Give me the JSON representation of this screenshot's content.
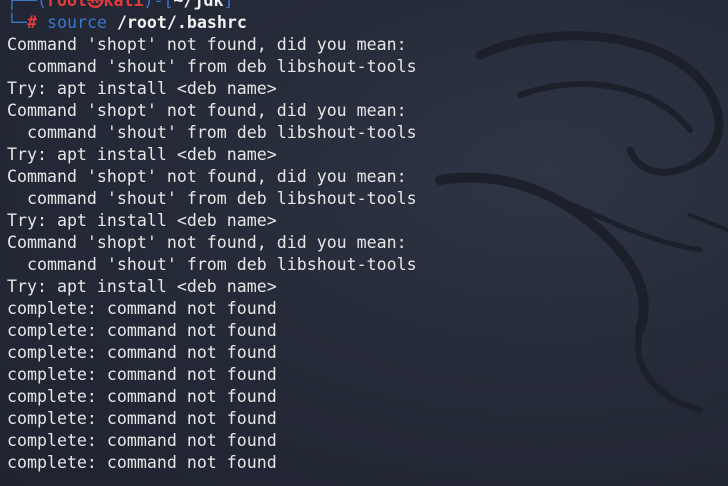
{
  "prompt": {
    "corner_top": "┌──(",
    "user": "root",
    "skull": "㉿",
    "host": "kali",
    "between": ")-[",
    "cwd": "~/jdk",
    "close": "]",
    "corner_bottom": "└─",
    "hash": "#",
    "command": "source",
    "argument": "/root/.bashrc"
  },
  "output": [
    "Command 'shopt' not found, did you mean:",
    "  command 'shout' from deb libshout-tools",
    "Try: apt install <deb name>",
    "Command 'shopt' not found, did you mean:",
    "  command 'shout' from deb libshout-tools",
    "Try: apt install <deb name>",
    "Command 'shopt' not found, did you mean:",
    "  command 'shout' from deb libshout-tools",
    "Try: apt install <deb name>",
    "Command 'shopt' not found, did you mean:",
    "  command 'shout' from deb libshout-tools",
    "Try: apt install <deb name>",
    "complete: command not found",
    "complete: command not found",
    "complete: command not found",
    "complete: command not found",
    "complete: command not found",
    "complete: command not found",
    "complete: command not found",
    "complete: command not found"
  ],
  "colors": {
    "background": "#262b39",
    "prompt_frame": "#3d76c9",
    "prompt_user": "#e23b3b",
    "text": "#e6e6e6"
  }
}
